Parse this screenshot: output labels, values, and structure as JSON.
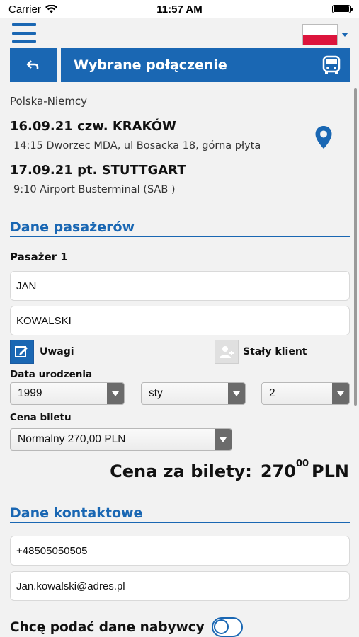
{
  "status_bar": {
    "carrier": "Carrier",
    "time": "11:57 AM"
  },
  "header": {
    "title": "Wybrane połączenie"
  },
  "route": {
    "name": "Polska-Niemcy",
    "departure": {
      "line": "16.09.21 czw. KRAKÓW",
      "detail": "14:15 Dworzec MDA, ul Bosacka 18, górna płyta"
    },
    "arrival": {
      "line": "17.09.21 pt. STUTTGART",
      "detail": "9:10 Airport Busterminal (SAB )"
    }
  },
  "passengers": {
    "section_title": "Dane pasażerów",
    "passenger_label": "Pasażer 1",
    "first_name": "JAN",
    "last_name": "KOWALSKI",
    "notes_label": "Uwagi",
    "regular_client_label": "Stały klient",
    "birth_date_label": "Data urodzenia",
    "birth_year": "1999",
    "birth_month": "sty",
    "birth_day": "2",
    "ticket_price_label": "Cena biletu",
    "ticket_type": "Normalny 270,00 PLN"
  },
  "total": {
    "label": "Cena za bilety:",
    "amount_main": "270",
    "amount_cents": "00",
    "currency": "PLN"
  },
  "contact": {
    "section_title": "Dane kontaktowe",
    "phone": "+48505050505",
    "email": "Jan.kowalski@adres.pl"
  },
  "buyer": {
    "label": "Chcę podać dane nabywcy",
    "toggle_on": false
  },
  "colors": {
    "accent": "#1a67b3",
    "flag_red": "#dc143c"
  }
}
